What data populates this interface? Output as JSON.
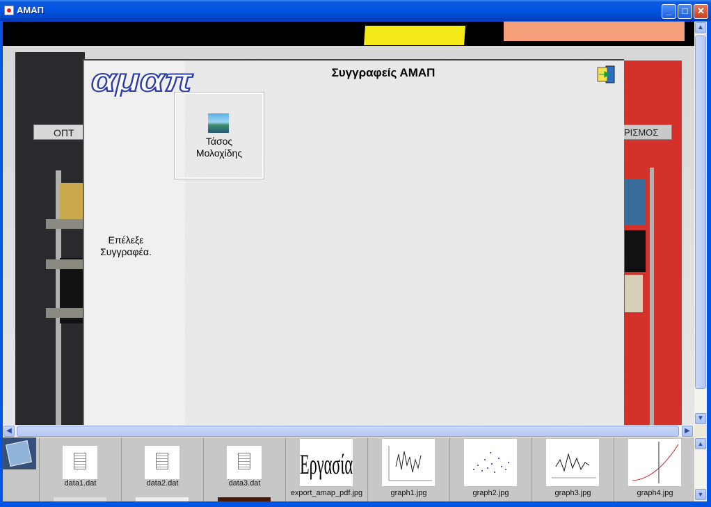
{
  "window": {
    "title": "ΑΜΑΠ"
  },
  "panel": {
    "title": "Συγγραφείς ΑΜΑΠ",
    "logo_text": "αμαπ",
    "instruction_line1": "Επέλεξε",
    "instruction_line2": "Συγγραφέα."
  },
  "authors": [
    {
      "name_line1": "Τάσος",
      "name_line2": "Μολοχίδης"
    }
  ],
  "background": {
    "left_sign": "ΟΠΤ",
    "right_sign": "ΡΙΣΜΟΣ"
  },
  "files": [
    {
      "name": "data1.dat",
      "kind": "doc"
    },
    {
      "name": "data2.dat",
      "kind": "doc"
    },
    {
      "name": "data3.dat",
      "kind": "doc"
    },
    {
      "name": "export_amap_pdf.jpg",
      "kind": "text-image",
      "image_text": "Εργασία"
    },
    {
      "name": "graph1.jpg",
      "kind": "graph"
    },
    {
      "name": "graph2.jpg",
      "kind": "graph"
    },
    {
      "name": "graph3.jpg",
      "kind": "graph"
    },
    {
      "name": "graph4.jpg",
      "kind": "graph"
    }
  ],
  "icons": {
    "app": "java-icon",
    "exit": "exit-door-icon",
    "author": "landscape-photo-icon",
    "tool": "notepad-icon",
    "file_doc": "document-icon"
  },
  "colors": {
    "titlebar": "#0054e3",
    "close_button": "#d04a2a",
    "panel_bg": "#e6e6e6",
    "right_wall": "#d3322a",
    "yellow_accent": "#f3e818"
  }
}
